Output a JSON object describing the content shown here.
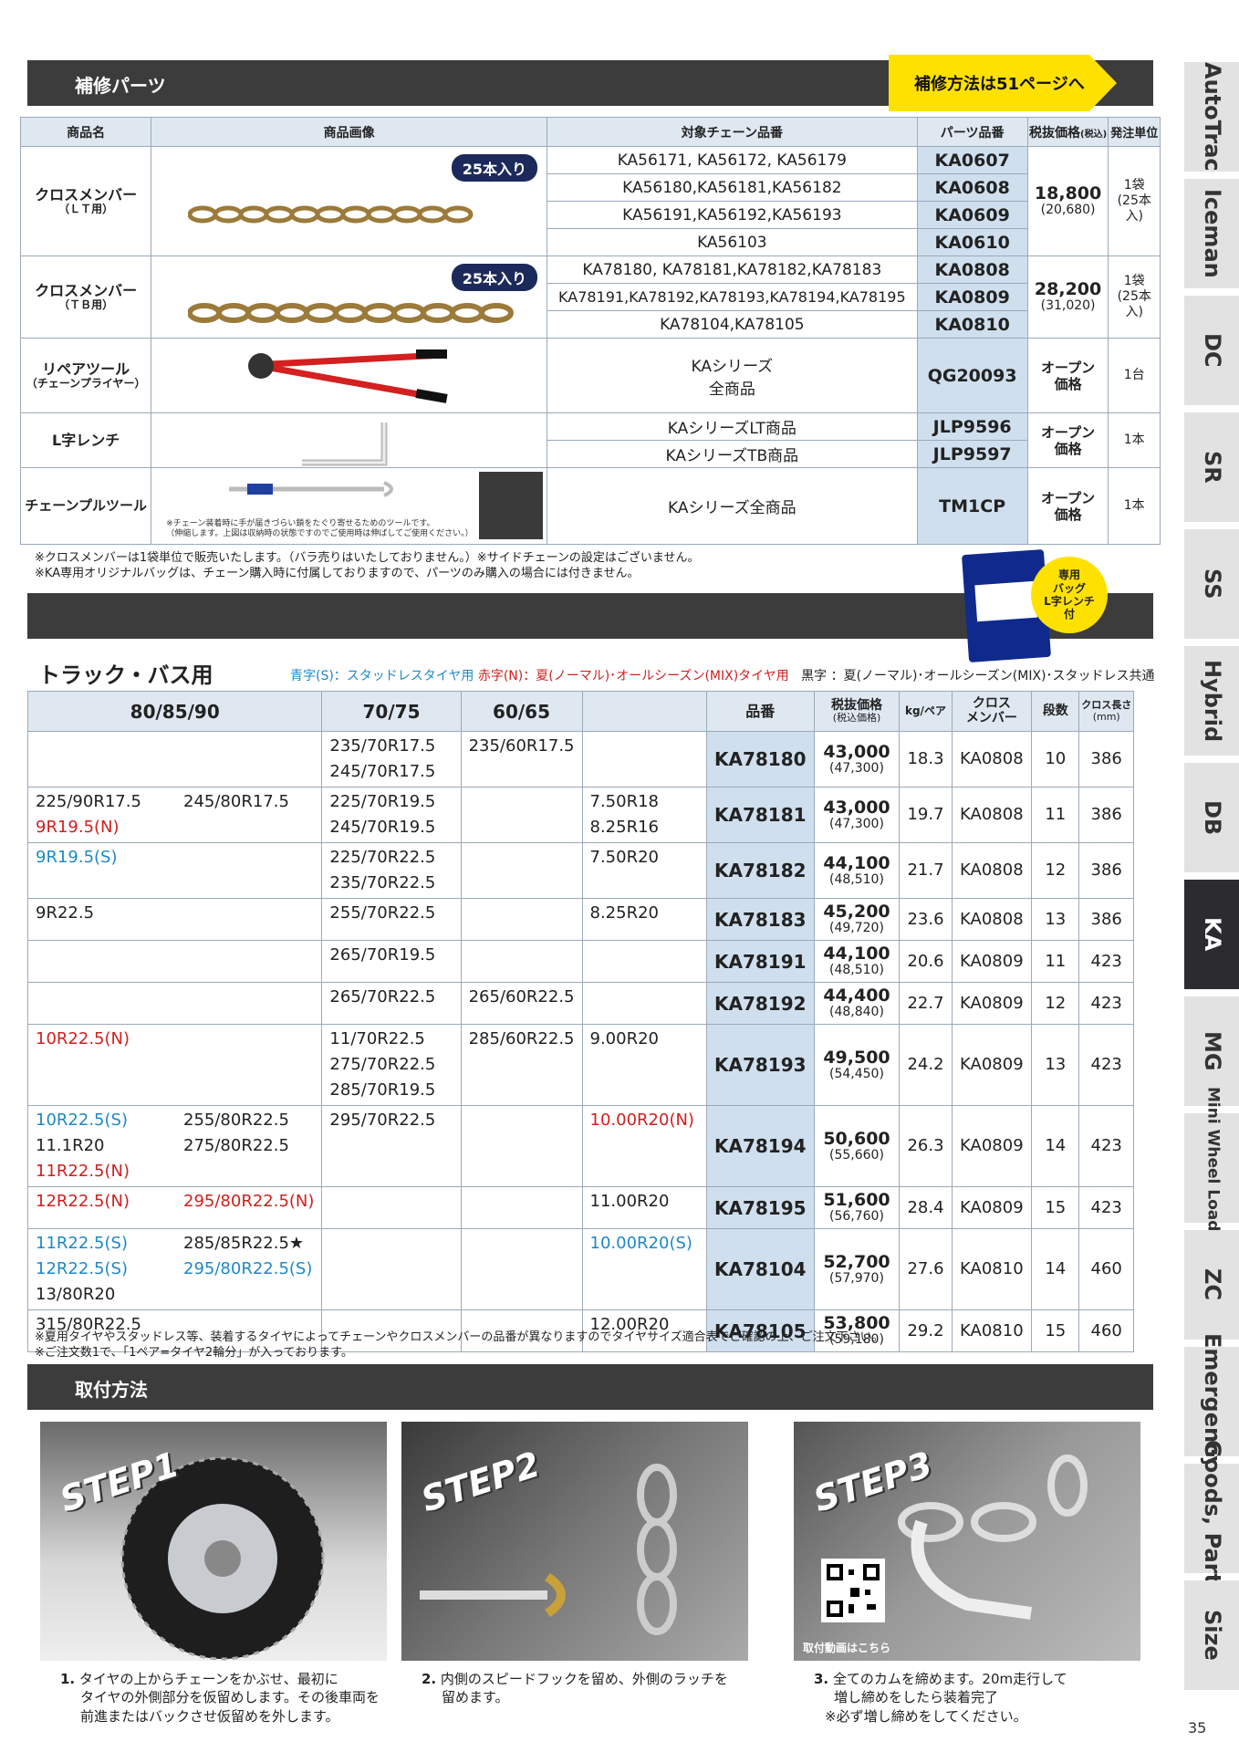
{
  "repair": {
    "title": "補修パーツ",
    "tag": "補修方法は51ページへ",
    "headers": [
      "商品名",
      "商品画像",
      "対象チェーン品番",
      "パーツ品番",
      "税抜価格",
      "(税込)",
      "発注単位"
    ],
    "badge": "25本入り",
    "lt": {
      "name": "クロスメンバー",
      "sub": "（ＬＴ用）",
      "rows": [
        {
          "target": "KA56171, KA56172, KA56179",
          "code": "KA0607"
        },
        {
          "target": "KA56180,KA56181,KA56182",
          "code": "KA0608"
        },
        {
          "target": "KA56191,KA56192,KA56193",
          "code": "KA0609"
        },
        {
          "target": "KA56103",
          "code": "KA0610"
        }
      ],
      "price": "18,800",
      "price_tax": "(20,680)",
      "unit": "1袋",
      "unit_sub": "(25本入)"
    },
    "tb": {
      "name": "クロスメンバー",
      "sub": "（ＴＢ用）",
      "rows": [
        {
          "target": "KA78180, KA78181,KA78182,KA78183",
          "code": "KA0808"
        },
        {
          "target": "KA78191,KA78192,KA78193,KA78194,KA78195",
          "code": "KA0809"
        },
        {
          "target": "KA78104,KA78105",
          "code": "KA0810"
        }
      ],
      "price": "28,200",
      "price_tax": "(31,020)",
      "unit": "1袋",
      "unit_sub": "(25本入)"
    },
    "repair_tool": {
      "name": "リペアツール",
      "sub": "（チェーンプライヤー）",
      "target1": "KAシリーズ",
      "target2": "全商品",
      "code": "QG20093",
      "price1": "オープン",
      "price2": "価格",
      "unit": "1台"
    },
    "wrench": {
      "name": "L字レンチ",
      "rows": [
        {
          "target": "KAシリーズLT商品",
          "code": "JLP9596"
        },
        {
          "target": "KAシリーズTB商品",
          "code": "JLP9597"
        }
      ],
      "price1": "オープン",
      "price2": "価格",
      "unit": "1本"
    },
    "pull_tool": {
      "name": "チェーンプルツール",
      "note1": "※チェーン装着時に手が届きづらい鎖をたぐり寄せるためのツールです。",
      "note2": "（伸縮します。上図は収納時の状態ですのでご使用時は伸ばしてご使用ください。）",
      "target": "KAシリーズ全商品",
      "code": "TM1CP",
      "price1": "オープン",
      "price2": "価格",
      "unit": "1本"
    },
    "notes": [
      "※クロスメンバーは1袋単位で販売いたします。（バラ売りはいたしておりません。）※サイドチェーンの設定はございません。",
      "※KA専用オリジナルバッグは、チェーン購入時に付属しておりますので、パーツのみ購入の場合には付きません。"
    ],
    "bag_badge": [
      "専用",
      "バッグ",
      "L字レンチ",
      "付"
    ]
  },
  "truck": {
    "title": "トラック・バス用",
    "legend_blue": "青字(S)：スタッドレスタイヤ用",
    "legend_red": "赤字(N)：夏(ノーマル)･オールシーズン(MIX)タイヤ用",
    "legend_black": "黒字 ：夏(ノーマル)･オールシーズン(MIX)･スタッドレス共通",
    "headers": {
      "h1": "80/85/90",
      "h2": "70/75",
      "h3": "60/65",
      "h4": "",
      "code": "品番",
      "price": "税抜価格",
      "price_sub": "(税込価格)",
      "kg": "kg/ペア",
      "cross": "クロス",
      "cross2": "メンバー",
      "steps": "段数",
      "len": "クロス長さ",
      "len_sub": "(mm)"
    },
    "rows": [
      {
        "c1": [],
        "c2": [
          "235/70R17.5",
          "245/70R17.5"
        ],
        "c3": [
          "235/60R17.5"
        ],
        "c4": [],
        "code": "KA78180",
        "price": "43,000",
        "tax": "(47,300)",
        "kg": "18.3",
        "cross": "KA0808",
        "steps": "10",
        "len": "386"
      },
      {
        "c1": [
          {
            "a": "225/90R17.5",
            "ac": "",
            "b": "245/80R17.5",
            "bc": ""
          },
          {
            "a": "9R19.5(N)",
            "ac": "red",
            "b": "",
            "bc": ""
          }
        ],
        "c2": [
          "225/70R19.5",
          "245/70R19.5"
        ],
        "c3": [],
        "c4": [
          "7.50R18",
          "8.25R16"
        ],
        "code": "KA78181",
        "price": "43,000",
        "tax": "(47,300)",
        "kg": "19.7",
        "cross": "KA0808",
        "steps": "11",
        "len": "386"
      },
      {
        "c1": [
          {
            "a": "9R19.5(S)",
            "ac": "blue",
            "b": "",
            "bc": ""
          }
        ],
        "c2": [
          "225/70R22.5",
          "235/70R22.5"
        ],
        "c3": [],
        "c4": [
          "7.50R20"
        ],
        "code": "KA78182",
        "price": "44,100",
        "tax": "(48,510)",
        "kg": "21.7",
        "cross": "KA0808",
        "steps": "12",
        "len": "386"
      },
      {
        "c1": [
          {
            "a": "9R22.5",
            "ac": "",
            "b": "",
            "bc": ""
          }
        ],
        "c2": [
          "255/70R22.5"
        ],
        "c3": [],
        "c4": [
          "8.25R20"
        ],
        "code": "KA78183",
        "price": "45,200",
        "tax": "(49,720)",
        "kg": "23.6",
        "cross": "KA0808",
        "steps": "13",
        "len": "386"
      },
      {
        "c1": [],
        "c2": [
          "265/70R19.5"
        ],
        "c3": [],
        "c4": [],
        "code": "KA78191",
        "price": "44,100",
        "tax": "(48,510)",
        "kg": "20.6",
        "cross": "KA0809",
        "steps": "11",
        "len": "423"
      },
      {
        "c1": [],
        "c2": [
          "265/70R22.5"
        ],
        "c3": [
          "265/60R22.5"
        ],
        "c4": [],
        "code": "KA78192",
        "price": "44,400",
        "tax": "(48,840)",
        "kg": "22.7",
        "cross": "KA0809",
        "steps": "12",
        "len": "423"
      },
      {
        "c1": [
          {
            "a": "10R22.5(N)",
            "ac": "red",
            "b": "",
            "bc": ""
          }
        ],
        "c2": [
          "11/70R22.5",
          "275/70R22.5",
          "285/70R19.5"
        ],
        "c3": [
          "285/60R22.5"
        ],
        "c4": [
          "9.00R20"
        ],
        "code": "KA78193",
        "price": "49,500",
        "tax": "(54,450)",
        "kg": "24.2",
        "cross": "KA0809",
        "steps": "13",
        "len": "423"
      },
      {
        "c1": [
          {
            "a": "10R22.5(S)",
            "ac": "blue",
            "b": "255/80R22.5",
            "bc": ""
          },
          {
            "a": "11.1R20",
            "ac": "",
            "b": "275/80R22.5",
            "bc": ""
          },
          {
            "a": "11R22.5(N)",
            "ac": "red",
            "b": "",
            "bc": ""
          }
        ],
        "c2": [
          "295/70R22.5"
        ],
        "c3": [],
        "c4": [
          {
            "t": "10.00R20(N)",
            "c": "red"
          }
        ],
        "code": "KA78194",
        "price": "50,600",
        "tax": "(55,660)",
        "kg": "26.3",
        "cross": "KA0809",
        "steps": "14",
        "len": "423"
      },
      {
        "c1": [
          {
            "a": "12R22.5(N)",
            "ac": "red",
            "b": "295/80R22.5(N)",
            "bc": "red"
          }
        ],
        "c2": [],
        "c3": [],
        "c4": [
          "11.00R20"
        ],
        "code": "KA78195",
        "price": "51,600",
        "tax": "(56,760)",
        "kg": "28.4",
        "cross": "KA0809",
        "steps": "15",
        "len": "423"
      },
      {
        "c1": [
          {
            "a": "11R22.5(S)",
            "ac": "blue",
            "b": "285/85R22.5★",
            "bc": ""
          },
          {
            "a": "12R22.5(S)",
            "ac": "blue",
            "b": "295/80R22.5(S)",
            "bc": "blue"
          },
          {
            "a": "13/80R20",
            "ac": "",
            "b": "",
            "bc": ""
          }
        ],
        "c2": [],
        "c3": [],
        "c4": [
          {
            "t": "10.00R20(S)",
            "c": "blue"
          }
        ],
        "code": "KA78104",
        "price": "52,700",
        "tax": "(57,970)",
        "kg": "27.6",
        "cross": "KA0810",
        "steps": "14",
        "len": "460"
      },
      {
        "c1": [
          {
            "a": "315/80R22.5",
            "ac": "",
            "b": "",
            "bc": ""
          }
        ],
        "c2": [],
        "c3": [],
        "c4": [
          "12.00R20"
        ],
        "code": "KA78105",
        "price": "53,800",
        "tax": "(59,180)",
        "kg": "29.2",
        "cross": "KA0810",
        "steps": "15",
        "len": "460"
      }
    ],
    "notes": [
      "※夏用タイヤやスタッドレス等、装着するタイヤによってチェーンやクロスメンバーの品番が異なりますのでタイヤサイズ適合表でご確認の上、ご注文下さい。",
      "※ご注文数1で、「1ペア=タイヤ2輪分」が入っております。"
    ]
  },
  "install": {
    "title": "取付方法",
    "steps": [
      {
        "label": "STEP1",
        "num": "1.",
        "text": [
          "タイヤの上からチェーンをかぶせ、最初に",
          "タイヤの外側部分を仮留めします。その後車両を",
          "前進またはバックさせ仮留めを外します。"
        ]
      },
      {
        "label": "STEP2",
        "num": "2.",
        "text": [
          "内側のスピードフックを留め、外側のラッチを",
          "留めます。"
        ]
      },
      {
        "label": "STEP3",
        "num": "3.",
        "text": [
          "全てのカムを締めます。20m走行して",
          "増し締めをしたら装着完了",
          "※必ず増し締めをしてください。"
        ]
      }
    ],
    "qr_caption": "取付動画はこちら"
  },
  "side_tabs": [
    "AutoTrac",
    "Iceman",
    "DC",
    "SR",
    "SS",
    "Hybrid",
    "DB",
    "KA",
    "MG",
    "Mini Wheel Loader",
    "ZC",
    "Emergency",
    "Goods, Parts",
    "Size"
  ],
  "active_tab": "KA",
  "page_number": "35",
  "colors": {
    "blue_text": "#1e88c8",
    "red_text": "#d0201e",
    "highlight": "#ffe100",
    "dark_bar": "#3c3c3c"
  }
}
